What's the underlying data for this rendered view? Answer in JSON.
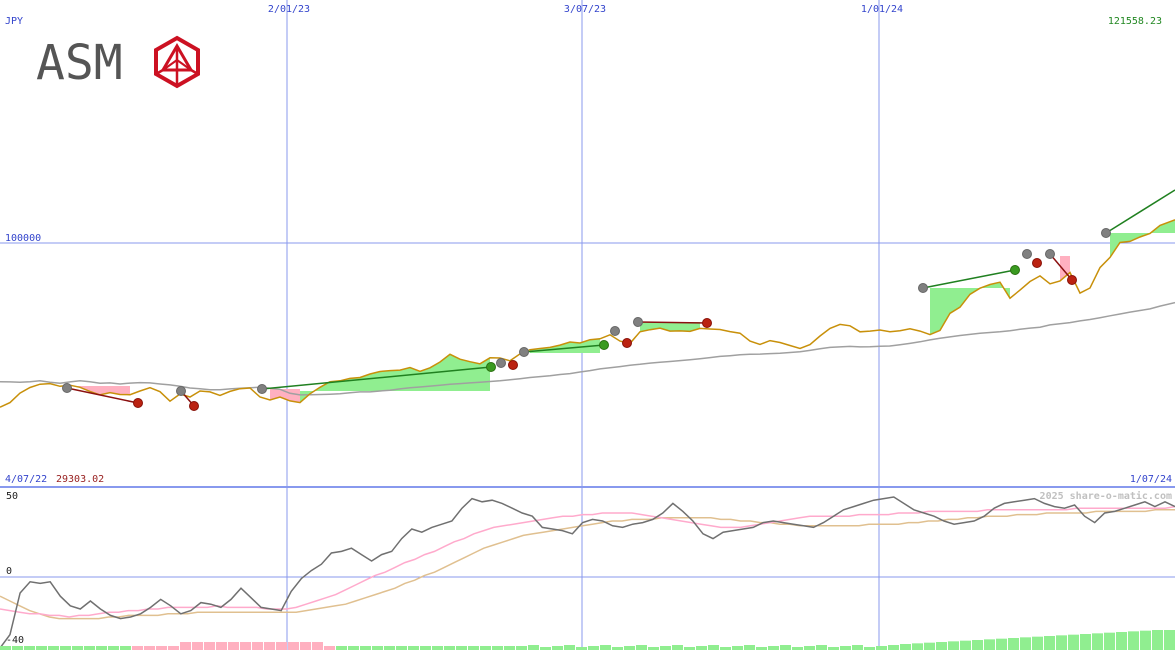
{
  "header": {
    "currency": "JPY",
    "last_price": "121558.23",
    "date_labels": [
      "2/01/23",
      "3/07/23",
      "1/01/24"
    ]
  },
  "logo": {
    "text": "ASM",
    "color": "#555555",
    "mark_color": "#cc1122"
  },
  "footer": {
    "start_date": "4/07/22",
    "start_value": "29303.02",
    "end_date": "1/07/24",
    "watermark": "2025 share-o-matic.com"
  },
  "colors": {
    "price": "#c8900a",
    "ma_long": "#a0a0a0",
    "up_fill": "#90ee90",
    "down_fill": "#ffb0c0",
    "up_line": "#208020",
    "down_line": "#8b1010",
    "grid": "#8899ee",
    "osc": "#707070",
    "osc_pink": "#ffaacc",
    "osc_tan": "#e0c090",
    "label_blue": "#3344cc",
    "label_green": "#228822",
    "label_red": "#992222"
  },
  "chart_data": [
    {
      "type": "line",
      "title": "",
      "ylabel": "JPY",
      "ylim": [
        28000,
        122500
      ],
      "yticks": [
        {
          "value": 100000,
          "label": "100000"
        }
      ],
      "x": [
        0,
        10,
        20,
        30,
        40,
        50,
        60,
        70,
        80,
        90,
        100,
        110,
        120,
        130,
        140,
        150,
        160,
        170,
        180,
        190,
        200,
        210,
        220,
        230,
        240,
        250,
        260,
        270,
        280,
        290,
        300,
        310,
        320,
        330,
        340,
        350,
        360,
        370,
        380,
        390,
        400,
        410,
        420,
        430,
        440,
        450,
        460,
        470,
        480,
        490,
        500,
        510,
        520,
        530,
        540,
        550,
        560,
        570,
        580,
        590,
        600,
        610,
        620,
        630,
        640,
        650,
        660,
        670,
        680,
        690,
        700,
        710,
        720,
        730,
        740,
        750,
        760,
        770,
        780,
        790,
        800,
        810,
        820,
        830,
        840,
        850,
        860,
        870,
        880,
        890,
        900,
        910,
        920,
        930,
        940,
        950,
        960,
        970,
        980,
        990,
        1000,
        1010,
        1020,
        1030,
        1040,
        1050,
        1060,
        1070,
        1080,
        1090,
        1100,
        1110,
        1120,
        1130,
        1140,
        1150,
        1160,
        1175
      ],
      "x_tick_labels": [
        {
          "x": 287,
          "label": "2/01/23"
        },
        {
          "x": 582,
          "label": "3/07/23"
        },
        {
          "x": 879,
          "label": "1/01/24"
        }
      ],
      "series": [
        {
          "name": "price",
          "values": [
            29200,
            31200,
            35300,
            37700,
            39100,
            39400,
            38200,
            38700,
            37800,
            36000,
            34500,
            35500,
            34700,
            34600,
            36200,
            37600,
            35900,
            31800,
            34900,
            33600,
            36200,
            35800,
            34300,
            36000,
            37200,
            37500,
            33600,
            32300,
            33600,
            31900,
            31200,
            35000,
            37800,
            40200,
            40600,
            41600,
            42000,
            43500,
            44600,
            45000,
            45200,
            46300,
            44700,
            46200,
            48700,
            52000,
            49900,
            48800,
            47900,
            50500,
            50400,
            49200,
            52200,
            54000,
            54500,
            55000,
            56000,
            57300,
            56900,
            58300,
            58700,
            60400,
            57700,
            56700,
            61700,
            62600,
            63300,
            62000,
            62100,
            61900,
            63200,
            62900,
            62700,
            61800,
            61100,
            57700,
            56300,
            57900,
            57100,
            55800,
            54500,
            56200,
            59900,
            63200,
            64900,
            64300,
            61700,
            62000,
            62500,
            61700,
            62200,
            63000,
            62000,
            60500,
            62300,
            69700,
            72300,
            77900,
            80500,
            82100,
            83100,
            76200,
            79700,
            83400,
            85800,
            82400,
            83600,
            87300,
            78400,
            80600,
            89400,
            93800,
            100200,
            100700,
            102600,
            104100,
            107600,
            110000,
            114700,
            121600
          ]
        },
        {
          "name": "ma_long",
          "values": [
            40200,
            40100,
            40000,
            40200,
            40600,
            40000,
            39500,
            40100,
            40600,
            40200,
            39500,
            39700,
            39200,
            39600,
            39800,
            39700,
            39200,
            38800,
            38200,
            37500,
            37200,
            36700,
            36700,
            37100,
            37400,
            37600,
            37800,
            37400,
            36900,
            35200,
            34500,
            34600,
            34700,
            34800,
            35000,
            35400,
            35800,
            35800,
            36200,
            36500,
            37100,
            37600,
            37900,
            38300,
            38700,
            39100,
            39400,
            39700,
            40000,
            40300,
            40600,
            41000,
            41500,
            42000,
            42400,
            42800,
            43300,
            43700,
            44400,
            45000,
            45700,
            46200,
            46700,
            47300,
            47700,
            48200,
            48600,
            48900,
            49300,
            49700,
            50100,
            50600,
            51100,
            51400,
            51800,
            52000,
            52100,
            52300,
            52500,
            52800,
            53100,
            53700,
            54400,
            55000,
            55200,
            55400,
            55200,
            55300,
            55500,
            55600,
            56100,
            56700,
            57400,
            58200,
            58900,
            59500,
            60100,
            60600,
            61100,
            61400,
            61700,
            62200,
            62800,
            63300,
            63700,
            64700,
            65200,
            65700,
            66400,
            67000,
            67800,
            68600,
            69400,
            70200,
            70900,
            71600,
            72800,
            74300,
            76000,
            77100,
            78200,
            80700
          ]
        }
      ],
      "signals": {
        "buy_points": [
          [
            67,
            388
          ],
          [
            181,
            391
          ],
          [
            262,
            389
          ],
          [
            501,
            363
          ],
          [
            524,
            352
          ],
          [
            615,
            331
          ],
          [
            638,
            322
          ],
          [
            923,
            288
          ],
          [
            1027,
            254
          ],
          [
            1050,
            254
          ],
          [
            1106,
            233
          ]
        ],
        "sell_points": [
          [
            138,
            403
          ],
          [
            194,
            406
          ],
          [
            491,
            367
          ],
          [
            513,
            365
          ],
          [
            604,
            345
          ],
          [
            627,
            343
          ],
          [
            707,
            323
          ],
          [
            1015,
            270
          ],
          [
            1037,
            263
          ],
          [
            1072,
            280
          ]
        ]
      }
    },
    {
      "type": "line",
      "title": "",
      "ylim": [
        -40,
        50
      ],
      "yticks": [
        {
          "value": 50,
          "label": "50"
        },
        {
          "value": 0,
          "label": "0"
        },
        {
          "value": -40,
          "label": "-40"
        }
      ],
      "series": [
        {
          "name": "oscillator",
          "values": [
            -52,
            -36,
            -10,
            -3,
            -4,
            -3,
            -12,
            -18,
            -20,
            -15,
            -20,
            -24,
            -26,
            -25,
            -23,
            -19,
            -14,
            -18,
            -23,
            -21,
            -16,
            -17,
            -19,
            -14,
            -7,
            -13,
            -19,
            -20,
            -21,
            -9,
            -1,
            4,
            8,
            15,
            16,
            18,
            14,
            10,
            14,
            16,
            24,
            30,
            28,
            31,
            33,
            35,
            43,
            49,
            47,
            48,
            46,
            43,
            40,
            38,
            31,
            30,
            29,
            27,
            34,
            36,
            35,
            32,
            31,
            33,
            34,
            36,
            40,
            46,
            41,
            35,
            27,
            24,
            28,
            29,
            30,
            31,
            34,
            35,
            34,
            33,
            32,
            31,
            34,
            38,
            42,
            44,
            46,
            48,
            49,
            50,
            46,
            42,
            40,
            38,
            35,
            33,
            34,
            35,
            38,
            43,
            46,
            47,
            48,
            49,
            46,
            44,
            43,
            45,
            38,
            34,
            40,
            41,
            43,
            45,
            47,
            44,
            47,
            44
          ]
        },
        {
          "name": "signal_fast",
          "values": [
            -20,
            -21,
            -22,
            -23,
            -23,
            -24,
            -24,
            -25,
            -24,
            -24,
            -23,
            -22,
            -22,
            -21,
            -21,
            -20,
            -20,
            -19,
            -19,
            -19,
            -19,
            -19,
            -18,
            -19,
            -19,
            -19,
            -19,
            -20,
            -20,
            -20,
            -19,
            -17,
            -15,
            -13,
            -11,
            -8,
            -5,
            -2,
            1,
            3,
            6,
            9,
            11,
            14,
            16,
            19,
            22,
            24,
            27,
            29,
            31,
            32,
            33,
            34,
            35,
            36,
            37,
            38,
            38,
            39,
            39,
            40,
            40,
            40,
            40,
            39,
            38,
            37,
            36,
            35,
            34,
            33,
            32,
            31,
            31,
            31,
            32,
            33,
            34,
            35,
            36,
            37,
            38,
            38,
            38,
            38,
            38,
            39,
            39,
            39,
            39,
            40,
            40,
            40,
            41,
            41,
            41,
            41,
            41,
            41,
            42,
            42,
            42,
            42,
            42,
            42,
            42,
            42,
            42,
            43,
            43,
            43,
            43,
            43,
            43,
            43,
            43,
            43,
            43,
            44
          ]
        },
        {
          "name": "signal_slow",
          "values": [
            -12,
            -15,
            -18,
            -21,
            -23,
            -25,
            -26,
            -26,
            -26,
            -26,
            -26,
            -25,
            -25,
            -24,
            -24,
            -24,
            -24,
            -23,
            -23,
            -23,
            -22,
            -22,
            -22,
            -22,
            -22,
            -22,
            -22,
            -22,
            -22,
            -22,
            -22,
            -21,
            -20,
            -19,
            -18,
            -17,
            -15,
            -13,
            -11,
            -9,
            -7,
            -4,
            -2,
            1,
            3,
            6,
            9,
            12,
            15,
            18,
            20,
            22,
            24,
            26,
            27,
            28,
            29,
            30,
            31,
            32,
            33,
            34,
            35,
            35,
            36,
            36,
            36,
            37,
            37,
            37,
            37,
            37,
            37,
            36,
            36,
            35,
            35,
            34,
            34,
            33,
            33,
            32,
            32,
            32,
            32,
            32,
            32,
            32,
            33,
            33,
            33,
            33,
            34,
            34,
            35,
            35,
            36,
            36,
            37,
            37,
            38,
            38,
            38,
            39,
            39,
            39,
            40,
            40,
            40,
            40,
            40,
            41,
            41,
            41,
            41,
            41,
            41,
            42,
            42,
            42
          ]
        }
      ]
    }
  ]
}
